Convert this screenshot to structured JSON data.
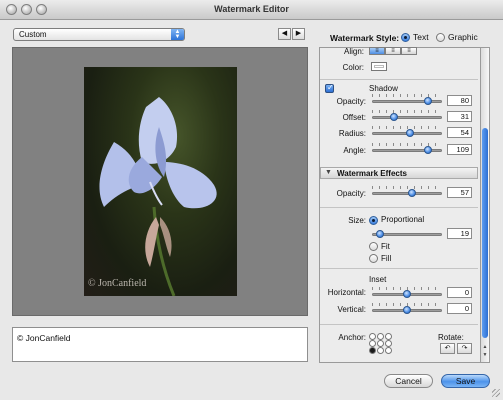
{
  "window": {
    "title": "Watermark Editor"
  },
  "preset": {
    "selected": "Custom"
  },
  "nav": {
    "prev": "◀",
    "next": "▶"
  },
  "watermark_style": {
    "label": "Watermark Style:",
    "options": [
      {
        "label": "Text",
        "selected": true
      },
      {
        "label": "Graphic",
        "selected": false
      }
    ]
  },
  "preview": {
    "watermark_text": "© JonCanfield"
  },
  "text_input": {
    "value": "© JonCanfield"
  },
  "text_settings": {
    "align_label": "Align:",
    "color_label": "Color:"
  },
  "shadow": {
    "label": "Shadow",
    "enabled": true,
    "opacity": {
      "label": "Opacity:",
      "value": "80",
      "fraction": 0.8
    },
    "offset": {
      "label": "Offset:",
      "value": "31",
      "fraction": 0.31
    },
    "radius": {
      "label": "Radius:",
      "value": "54",
      "fraction": 0.54
    },
    "angle": {
      "label": "Angle:",
      "value": "109",
      "fraction": 0.8
    }
  },
  "effects": {
    "title": "Watermark Effects",
    "opacity": {
      "label": "Opacity:",
      "value": "57",
      "fraction": 0.57
    },
    "size": {
      "label": "Size:",
      "options": [
        {
          "label": "Proportional",
          "selected": true
        },
        {
          "label": "Fit",
          "selected": false
        },
        {
          "label": "Fill",
          "selected": false
        }
      ],
      "value": "19",
      "fraction": 0.12
    }
  },
  "inset": {
    "title": "Inset",
    "horizontal": {
      "label": "Horizontal:",
      "value": "0",
      "fraction": 0.5
    },
    "vertical": {
      "label": "Vertical:",
      "value": "0",
      "fraction": 0.5
    }
  },
  "anchor": {
    "label": "Anchor:"
  },
  "rotate": {
    "label": "Rotate:",
    "left": "↶",
    "right": "↷"
  },
  "buttons": {
    "cancel": "Cancel",
    "save": "Save"
  },
  "colors": {
    "accent": "#3b7fde",
    "preview_bg": "#818181"
  }
}
